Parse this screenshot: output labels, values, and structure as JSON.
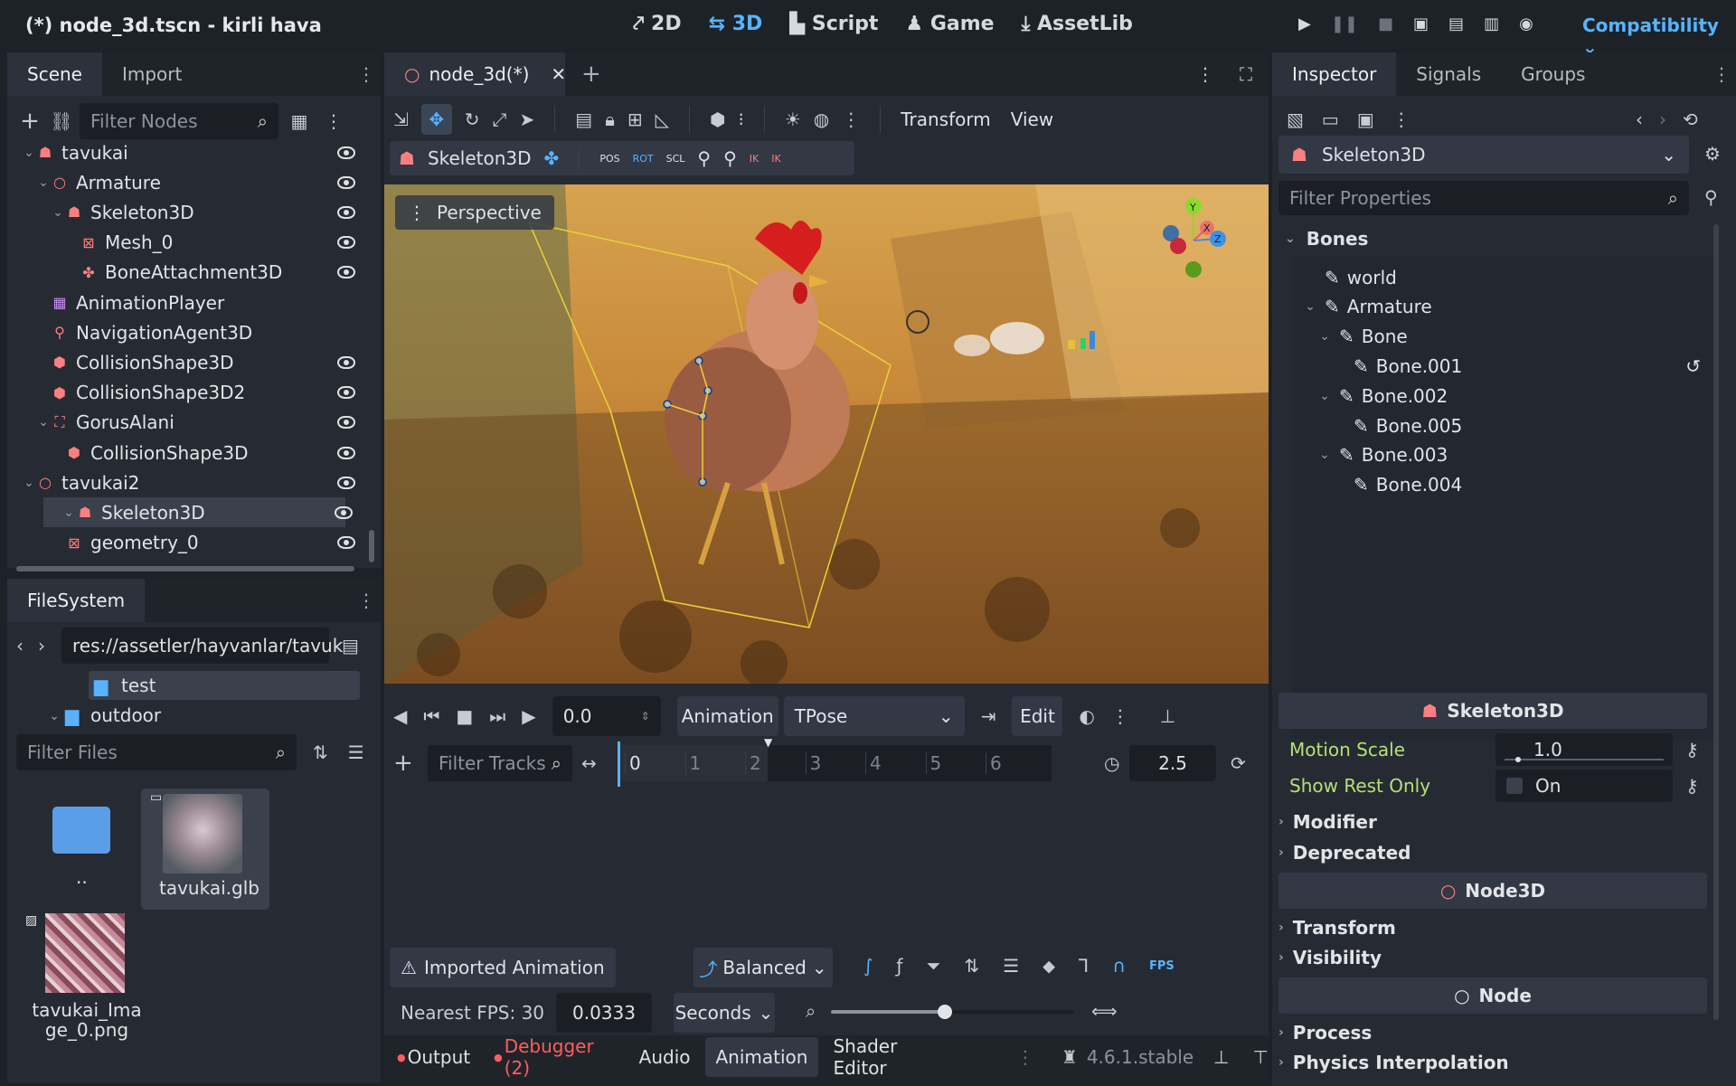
{
  "titlebar": {
    "title": "(*) node_3d.tscn - kirli hava",
    "modes": [
      "2D",
      "3D",
      "Script",
      "Game",
      "AssetLib"
    ],
    "renderer": "Compatibility"
  },
  "scene_dock": {
    "tabs": [
      "Scene",
      "Import"
    ],
    "filter_placeholder": "Filter Nodes",
    "nodes": [
      {
        "label": "tavukai",
        "icon": "skeleton-icon",
        "color": "#fc7f7f",
        "eye": true
      },
      {
        "label": "Armature",
        "icon": "node3d-icon",
        "color": "#fc7f7f",
        "eye": true
      },
      {
        "label": "Skeleton3D",
        "icon": "skeleton-icon",
        "color": "#fc7f7f",
        "eye": true
      },
      {
        "label": "Mesh_0",
        "icon": "mesh-icon",
        "color": "#fc7f7f",
        "eye": true
      },
      {
        "label": "BoneAttachment3D",
        "icon": "bone-attachment-icon",
        "color": "#fc7f7f",
        "eye": true
      },
      {
        "label": "AnimationPlayer",
        "icon": "animation-icon",
        "color": "#c38ef1",
        "eye": false
      },
      {
        "label": "NavigationAgent3D",
        "icon": "pin-icon",
        "color": "#fc7f7f",
        "eye": false
      },
      {
        "label": "CollisionShape3D",
        "icon": "collision-icon",
        "color": "#fc7f7f",
        "eye": true
      },
      {
        "label": "CollisionShape3D2",
        "icon": "collision-icon",
        "color": "#fc7f7f",
        "eye": true
      },
      {
        "label": "GorusAlani",
        "icon": "area-icon",
        "color": "#fc7f7f",
        "eye": true
      },
      {
        "label": "CollisionShape3D",
        "icon": "collision-icon",
        "color": "#fc7f7f",
        "eye": true
      },
      {
        "label": "tavukai2",
        "icon": "node3d-icon",
        "color": "#fc7f7f",
        "eye": true
      },
      {
        "label": "Skeleton3D",
        "icon": "skeleton-icon",
        "color": "#fc7f7f",
        "eye": true
      },
      {
        "label": "geometry_0",
        "icon": "mesh-icon",
        "color": "#fc7f7f",
        "eye": true
      }
    ]
  },
  "filesystem": {
    "tab": "FileSystem",
    "path": "res://assetler/hayvanlar/tavuk",
    "tree": [
      "test",
      "outdoor"
    ],
    "filter_placeholder": "Filter Files",
    "files": [
      "..",
      "tavukai.glb",
      "tavukai_Image_0.png"
    ]
  },
  "viewport": {
    "tab": "node_3d(*)",
    "menus": [
      "Transform",
      "View"
    ],
    "skeleton_label": "Skeleton3D",
    "perspective": "Perspective",
    "gizmo_axes": [
      "Y",
      "X",
      "Z"
    ]
  },
  "animation": {
    "time": "0.0",
    "anim_label": "Animation",
    "anim_name": "TPose",
    "edit": "Edit",
    "filter_tracks": "Filter Tracks",
    "ticks": [
      "0",
      "1",
      "2",
      "3",
      "4",
      "5",
      "6"
    ],
    "length": "2.5",
    "imported": "Imported Animation",
    "mode": "Balanced",
    "fps_label": "Nearest FPS: 30",
    "step": "0.0333",
    "unit": "Seconds",
    "fps_btn": "FPS"
  },
  "bottom_tabs": {
    "items": [
      "Output",
      "Debugger (2)",
      "Audio",
      "Animation",
      "Shader Editor"
    ],
    "version": "4.6.1.stable"
  },
  "inspector": {
    "tabs": [
      "Inspector",
      "Signals",
      "Groups"
    ],
    "node": "Skeleton3D",
    "filter_placeholder": "Filter Properties",
    "bones_header": "Bones",
    "bones": [
      "world",
      "Armature",
      "Bone",
      "Bone.001",
      "Bone.002",
      "Bone.005",
      "Bone.003",
      "Bone.004"
    ],
    "section_skeleton": "Skeleton3D",
    "motion_scale_label": "Motion Scale",
    "motion_scale": "1.0",
    "show_rest_label": "Show Rest Only",
    "show_rest_value": "On",
    "modifier": "Modifier",
    "deprecated": "Deprecated",
    "section_node3d": "Node3D",
    "transform": "Transform",
    "visibility": "Visibility",
    "section_node": "Node",
    "process": "Process",
    "physics": "Physics Interpolation"
  },
  "colors": {
    "accent": "#57b3ff",
    "node3d": "#fc7f7f",
    "prop_label": "#b5e079"
  }
}
